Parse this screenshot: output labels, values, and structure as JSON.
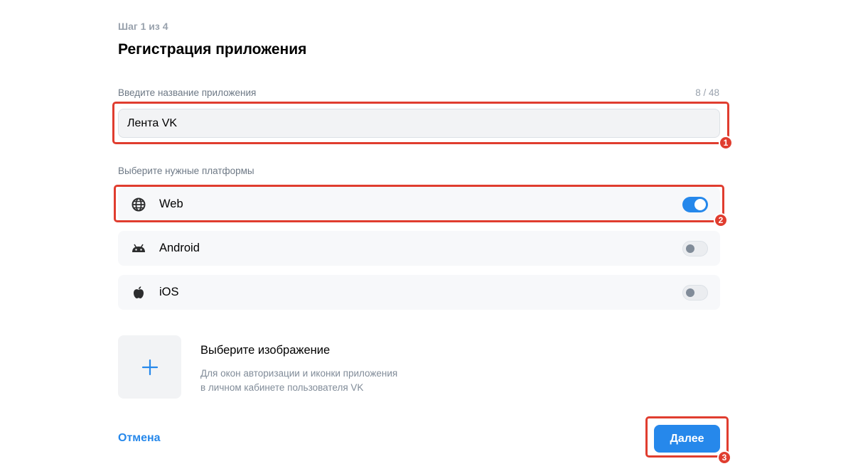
{
  "header": {
    "step": "Шаг 1 из 4",
    "title": "Регистрация приложения"
  },
  "app_name": {
    "label": "Введите название приложения",
    "counter": "8 / 48",
    "value": "Лента VK"
  },
  "platforms": {
    "label": "Выберите нужные платформы",
    "items": [
      {
        "name": "Web",
        "icon": "globe-icon",
        "enabled": true
      },
      {
        "name": "Android",
        "icon": "android-icon",
        "enabled": false
      },
      {
        "name": "iOS",
        "icon": "apple-icon",
        "enabled": false
      }
    ]
  },
  "image": {
    "icon": "plus-icon",
    "title": "Выберите изображение",
    "desc_line1": "Для окон авторизации и иконки приложения",
    "desc_line2": "в личном кабинете пользователя VK"
  },
  "footer": {
    "cancel_label": "Отмена",
    "next_label": "Далее"
  },
  "annotations": {
    "color": "#e03d2f",
    "badges": [
      "1",
      "2",
      "3"
    ]
  },
  "colors": {
    "accent": "#2688eb",
    "input_bg": "#f2f3f5",
    "row_bg": "#f7f8fa"
  }
}
